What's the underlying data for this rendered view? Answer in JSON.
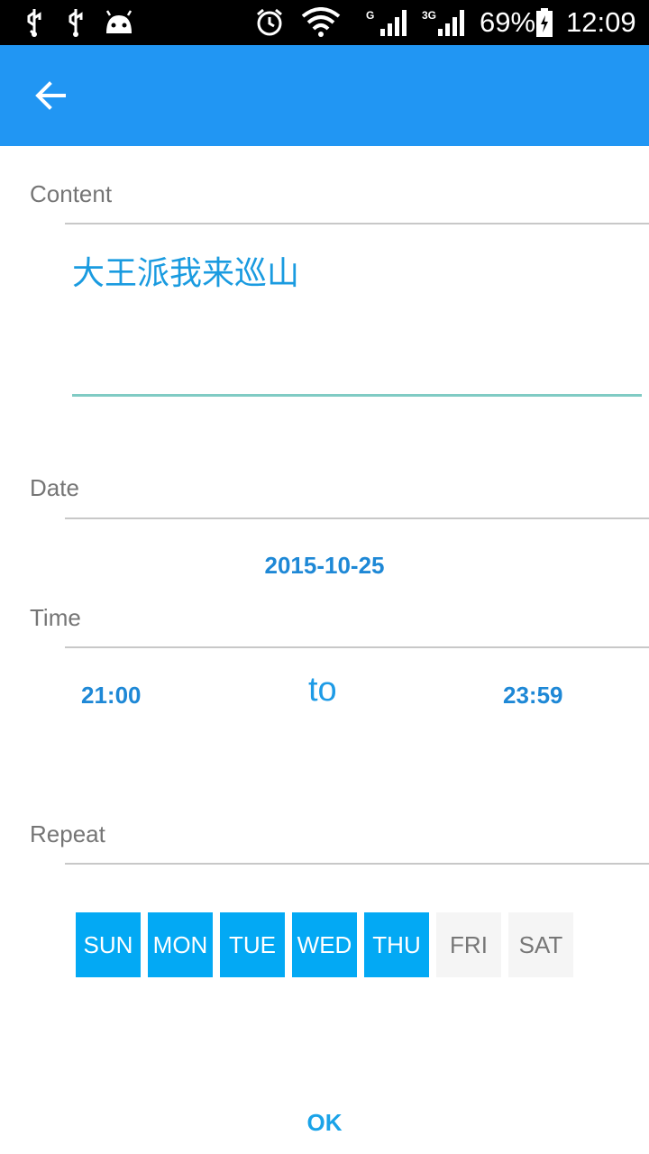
{
  "status_bar": {
    "icons": [
      "usb-icon",
      "usb-icon",
      "android-icon",
      "alarm-icon",
      "wifi-icon",
      "signal-icon",
      "signal-icon",
      "battery-icon"
    ],
    "network_1": "G",
    "network_2": "3G",
    "battery": "69%",
    "time": "12:09"
  },
  "app_bar": {
    "back_icon": "arrow-left-icon",
    "color": "#2196f3"
  },
  "form": {
    "content_label": "Content",
    "content_value": "大王派我来巡山",
    "date_label": "Date",
    "date_value": "2015-10-25",
    "time_label": "Time",
    "time_start": "21:00",
    "time_separator": "to",
    "time_end": "23:59",
    "repeat_label": "Repeat",
    "days": [
      {
        "label": "SUN",
        "selected": true
      },
      {
        "label": "MON",
        "selected": true
      },
      {
        "label": "TUE",
        "selected": true
      },
      {
        "label": "WED",
        "selected": true
      },
      {
        "label": "THU",
        "selected": true
      },
      {
        "label": "FRI",
        "selected": false
      },
      {
        "label": "SAT",
        "selected": false
      }
    ],
    "ok_label": "OK"
  },
  "colors": {
    "accent": "#03a9f4",
    "underline": "#80cbc4",
    "unselected_day": "#f5f5f5"
  }
}
